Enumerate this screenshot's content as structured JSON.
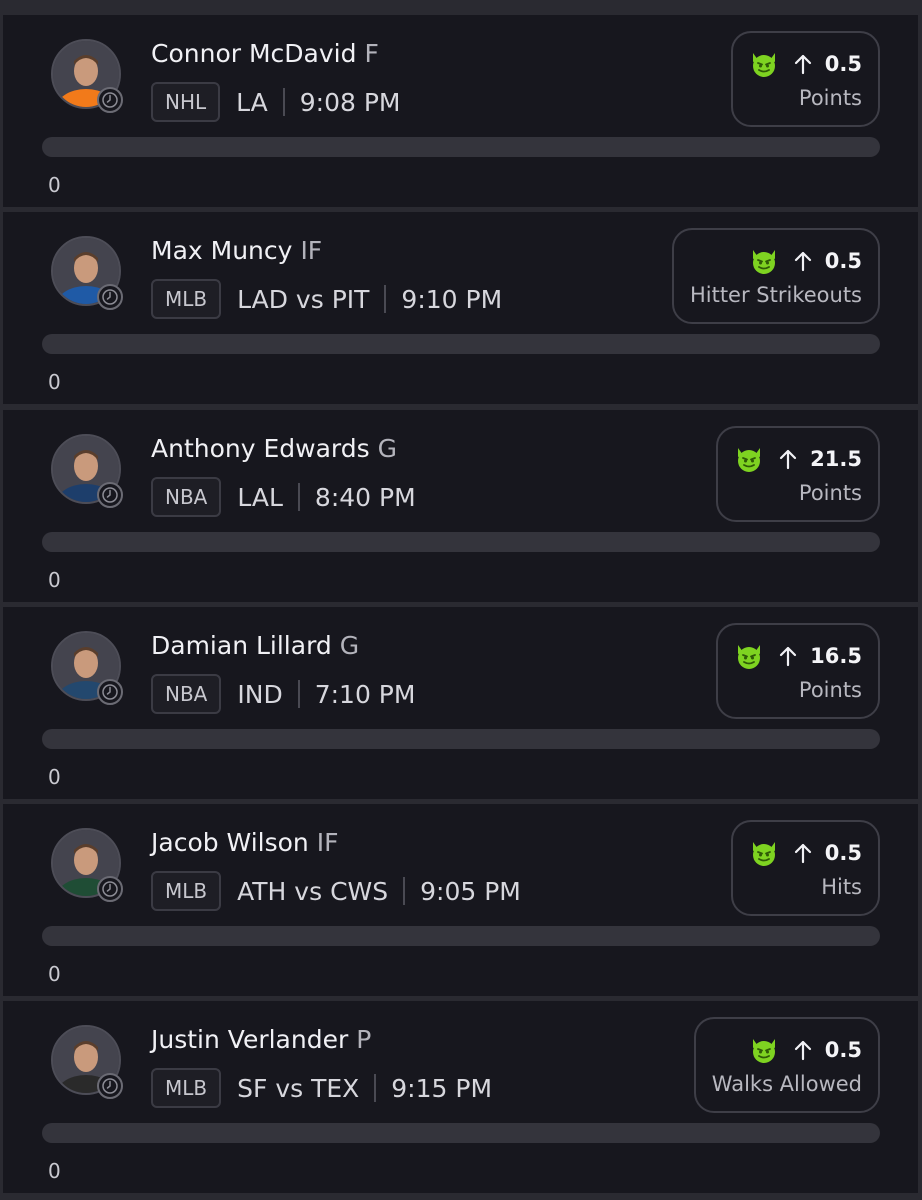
{
  "picks": [
    {
      "name": "Connor McDavid",
      "position": "F",
      "league": "NHL",
      "matchup": "LA",
      "time": "9:08 PM",
      "direction": "up",
      "line": "0.5",
      "stat": "Points",
      "progress": "0",
      "team_color": "#f27a1a",
      "avatar_icon": "player-headshot"
    },
    {
      "name": "Max Muncy",
      "position": "IF",
      "league": "MLB",
      "matchup": "LAD vs PIT",
      "time": "9:10 PM",
      "direction": "up",
      "line": "0.5",
      "stat": "Hitter Strikeouts",
      "progress": "0",
      "team_color": "#1f5aa6",
      "avatar_icon": "player-headshot"
    },
    {
      "name": "Anthony Edwards",
      "position": "G",
      "league": "NBA",
      "matchup": "LAL",
      "time": "8:40 PM",
      "direction": "up",
      "line": "21.5",
      "stat": "Points",
      "progress": "0",
      "team_color": "#1d3e6b",
      "avatar_icon": "player-headshot"
    },
    {
      "name": "Damian Lillard",
      "position": "G",
      "league": "NBA",
      "matchup": "IND",
      "time": "7:10 PM",
      "direction": "up",
      "line": "16.5",
      "stat": "Points",
      "progress": "0",
      "team_color": "#23486e",
      "avatar_icon": "player-headshot"
    },
    {
      "name": "Jacob Wilson",
      "position": "IF",
      "league": "MLB",
      "matchup": "ATH vs CWS",
      "time": "9:05 PM",
      "direction": "up",
      "line": "0.5",
      "stat": "Hits",
      "progress": "0",
      "team_color": "#1f4d35",
      "avatar_icon": "player-headshot"
    },
    {
      "name": "Justin Verlander",
      "position": "P",
      "league": "MLB",
      "matchup": "SF vs TEX",
      "time": "9:15 PM",
      "direction": "up",
      "line": "0.5",
      "stat": "Walks Allowed",
      "progress": "0",
      "team_color": "#2a2a2a",
      "avatar_icon": "player-headshot"
    }
  ],
  "colors": {
    "accent_emoji": "#7ed321",
    "card_bg": "#17171e",
    "divider": "#2a2a31"
  },
  "icons": {
    "status": "clock-icon",
    "direction": "arrow-up-icon",
    "badge": "devil-emoji-icon"
  }
}
